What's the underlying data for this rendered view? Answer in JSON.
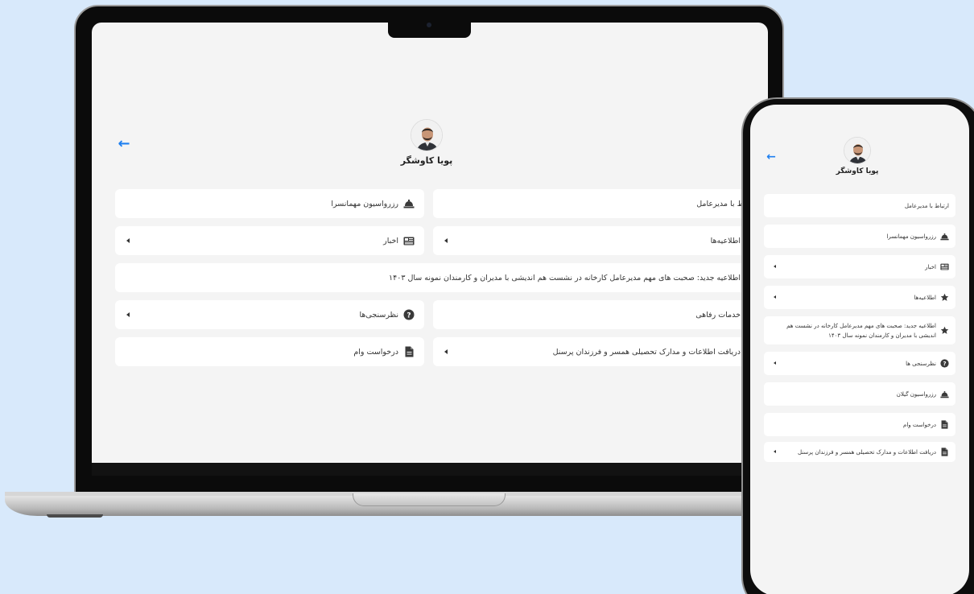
{
  "profile": {
    "name": "پویا کاوشگر"
  },
  "colors": {
    "accent": "#1e7ff0",
    "icon": "#3a3a3a",
    "background": "#d8e9fb"
  },
  "laptop": {
    "items": [
      {
        "label": "ارتباط با مدیرعامل",
        "icon": "none"
      },
      {
        "label": "رزرواسیون مهمانسرا",
        "icon": "bell-icon"
      },
      {
        "label": "اطلاعیه‌ها",
        "icon": "star-icon",
        "expandable": true
      },
      {
        "label": "اخبار",
        "icon": "news-icon",
        "expandable": true
      },
      {
        "label": "اطلاعیه جدید: صحبت های مهم مدیرعامل کارخانه در نشست هم اندیشی با مدیران و کارمندان نمونه سال ۱۴۰۳",
        "icon": "star-icon"
      },
      {
        "label": "خدمات رفاهی",
        "icon": "bell-icon"
      },
      {
        "label": "نظرسنجی‌ها",
        "icon": "question-icon",
        "expandable": true
      },
      {
        "label": "دریافت اطلاعات و مدارک تحصیلی همسر و فرزندان پرسنل",
        "icon": "document-icon",
        "expandable": true
      },
      {
        "label": "درخواست وام",
        "icon": "document-icon"
      }
    ]
  },
  "phone": {
    "items": [
      {
        "label": "ارتباط با مدیرعامل",
        "icon": "none"
      },
      {
        "label": "رزرواسیون مهمانسرا",
        "icon": "bell-icon"
      },
      {
        "label": "اخبار",
        "icon": "news-icon",
        "expandable": true
      },
      {
        "label": "اطلاعیه‌ها",
        "icon": "star-icon",
        "expandable": true
      },
      {
        "label": "اطلاعیه جدید: صحبت های مهم مدیرعامل کارخانه در نشست هم اندیشی با مدیران و کارمندان نمونه سال ۱۴۰۳",
        "icon": "star-icon"
      },
      {
        "label": "نظرسنجی ها",
        "icon": "question-icon",
        "expandable": true
      },
      {
        "label": "رزرواسیون گیلان",
        "icon": "bell-icon"
      },
      {
        "label": "درخواست وام",
        "icon": "document-icon"
      },
      {
        "label": "دریافت اطلاعات و مدارک تحصیلی همسر و فرزندان پرسنل",
        "icon": "document-icon",
        "expandable": true
      }
    ]
  }
}
